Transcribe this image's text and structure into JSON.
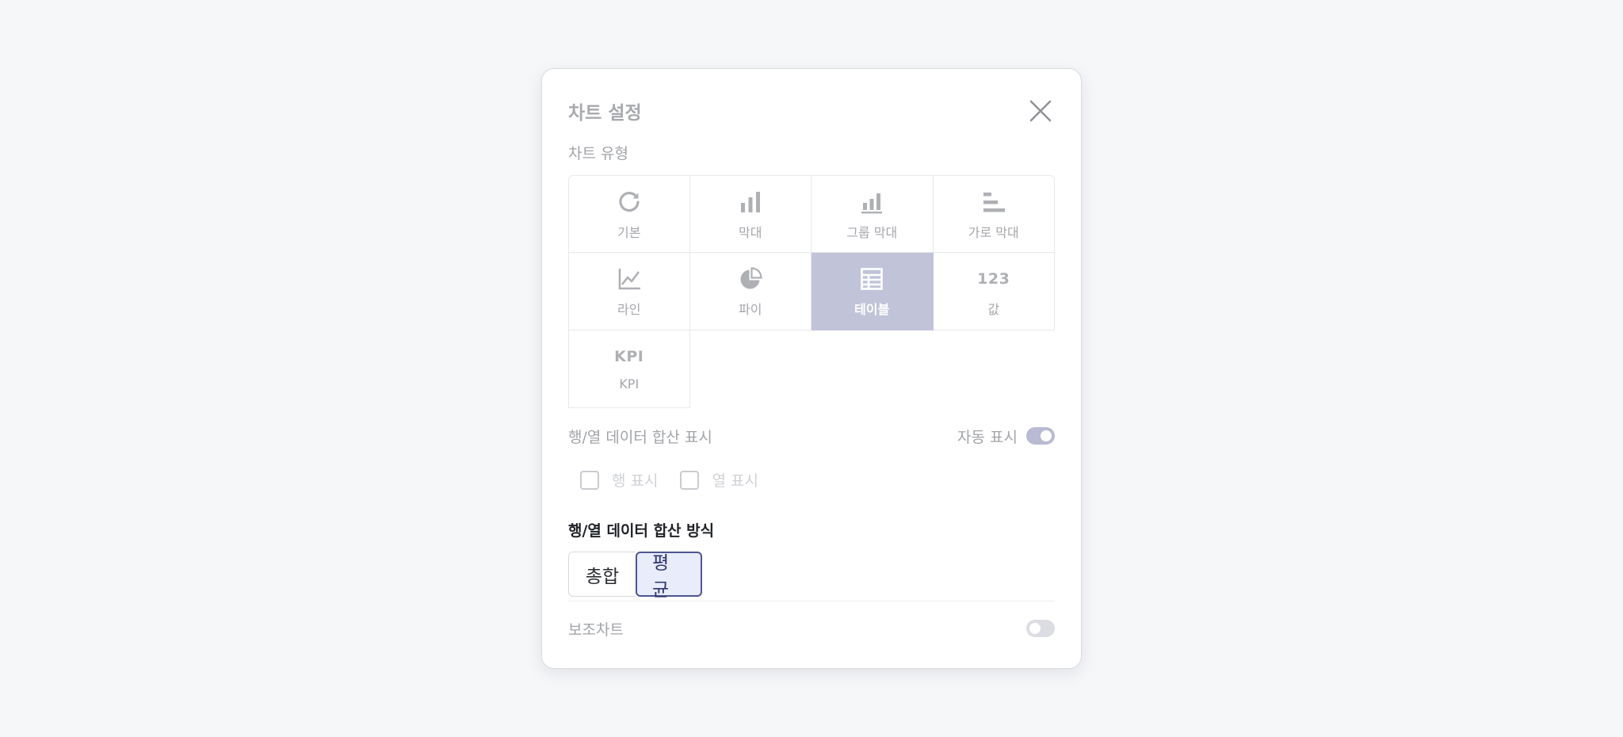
{
  "modal": {
    "title": "차트 설정",
    "close_label": "close"
  },
  "chart_type": {
    "label": "차트 유형",
    "items": [
      {
        "label": "기본",
        "icon": "refresh-icon"
      },
      {
        "label": "막대",
        "icon": "bar-chart-icon"
      },
      {
        "label": "그룹 막대",
        "icon": "grouped-bar-chart-icon"
      },
      {
        "label": "가로 막대",
        "icon": "horizontal-bar-chart-icon"
      },
      {
        "label": "라인",
        "icon": "line-chart-icon"
      },
      {
        "label": "파이",
        "icon": "pie-chart-icon"
      },
      {
        "label": "테이블",
        "icon": "table-icon",
        "selected": true
      },
      {
        "label": "값",
        "icon": "number-icon",
        "icon_text": "123"
      },
      {
        "label": "KPI",
        "icon": "kpi-icon",
        "icon_text": "KPI"
      }
    ]
  },
  "totals_display": {
    "label": "행/열 데이터 합산 표시",
    "auto_label": "자동 표시",
    "auto_on": true,
    "row_label": "행 표시",
    "col_label": "열 표시"
  },
  "totals_method": {
    "label": "행/열 데이터 합산 방식",
    "options": [
      "총합",
      "평균"
    ],
    "selected": "평균"
  },
  "sub_chart": {
    "label": "보조차트",
    "on": false
  },
  "colors": {
    "selected_cell": "#c1c3d8",
    "accent": "#4c5690",
    "toggle_on": "#b9bbd3"
  }
}
